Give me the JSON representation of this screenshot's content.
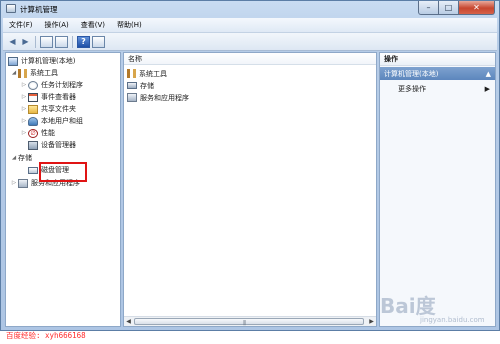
{
  "window": {
    "title": "计算机管理"
  },
  "menu": [
    "文件(F)",
    "操作(A)",
    "查看(V)",
    "帮助(H)"
  ],
  "toolbar": {
    "help": "?"
  },
  "tree": {
    "root": "计算机管理(本地)",
    "system_tools": "系统工具",
    "task_scheduler": "任务计划程序",
    "event_viewer": "事件查看器",
    "shared_folders": "共享文件夹",
    "local_users": "本地用户和组",
    "performance": "性能",
    "device_manager": "设备管理器",
    "storage": "存储",
    "disk_management": "磁盘管理",
    "services": "服务和应用程序"
  },
  "list": {
    "column_name": "名称",
    "items": [
      "系统工具",
      "存储",
      "服务和应用程序"
    ]
  },
  "actions": {
    "header": "操作",
    "group": "计算机管理(本地)",
    "more": "更多操作"
  },
  "footer": {
    "experience": "百度经验: xyh666168",
    "watermark": "Bai度",
    "watermark_sub": "jingyan.baidu.com"
  },
  "colors": {
    "highlight": "#e01414",
    "experience_text": "#ff2b2b",
    "action_group": "#5c86bd"
  }
}
